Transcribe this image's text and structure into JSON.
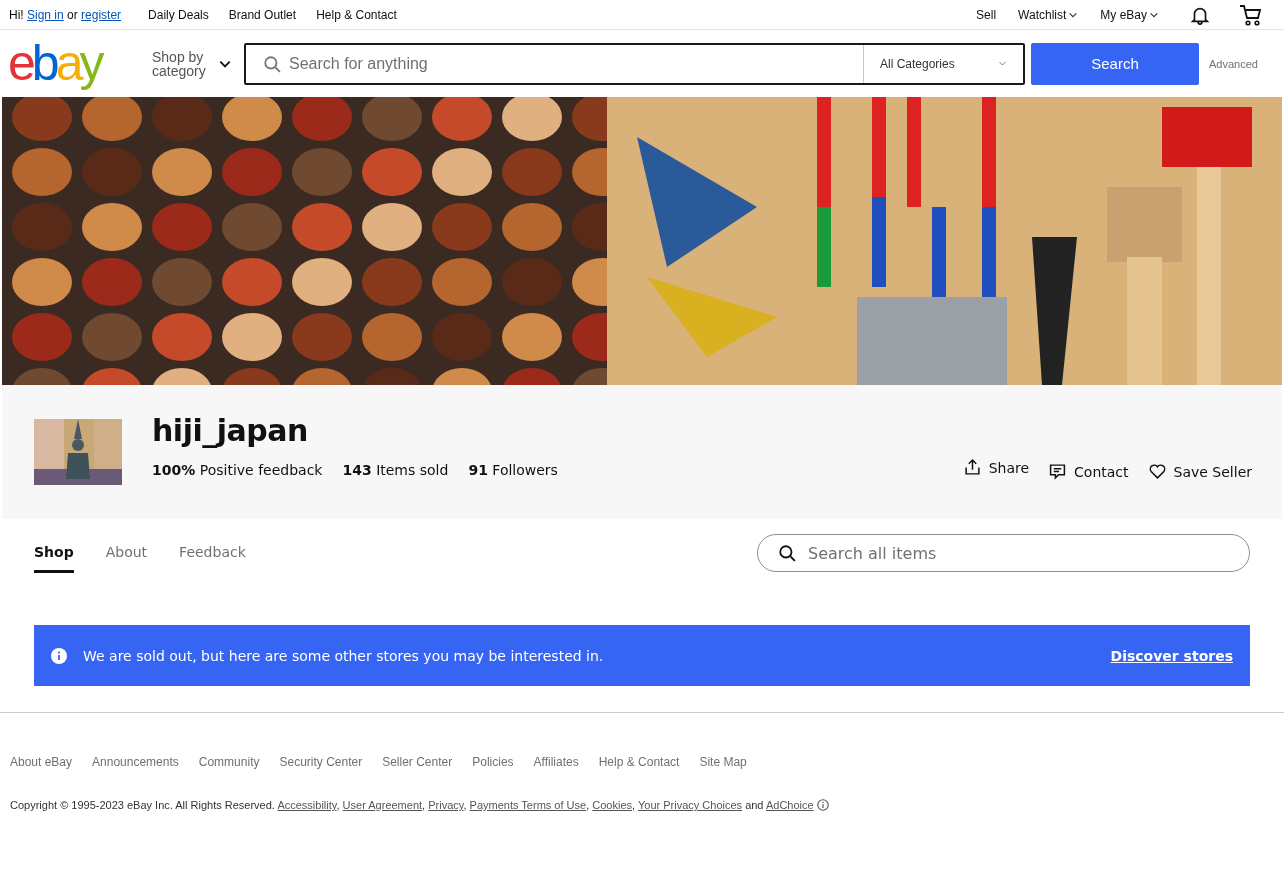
{
  "top_bar": {
    "greeting": "Hi!",
    "sign_in": "Sign in",
    "or": "or",
    "register": "register",
    "links": [
      "Daily Deals",
      "Brand Outlet",
      "Help & Contact"
    ],
    "right_links": [
      {
        "label": "Sell",
        "dropdown": false
      },
      {
        "label": "Watchlist",
        "dropdown": true
      },
      {
        "label": "My eBay",
        "dropdown": true
      }
    ]
  },
  "header": {
    "logo": [
      {
        "text": "e",
        "color": "#e53238"
      },
      {
        "text": "b",
        "color": "#0064d2"
      },
      {
        "text": "a",
        "color": "#f5af02"
      },
      {
        "text": "y",
        "color": "#86b817"
      }
    ],
    "shop_by_category": "Shop by category",
    "search_placeholder": "Search for anything",
    "category": "All Categories",
    "search_button": "Search",
    "advanced": "Advanced"
  },
  "banner": [
    {
      "kind": "crafts"
    },
    {
      "kind": "tools"
    }
  ],
  "seller": {
    "name": "hiji_japan",
    "stats": [
      "**100%** Positive feedback",
      "**143** Items sold",
      "**91** Followers"
    ],
    "actions": [
      {
        "kind": "share",
        "label": "Share"
      },
      {
        "kind": "contact",
        "label": "Contact"
      },
      {
        "kind": "save",
        "label": "Save Seller"
      }
    ]
  },
  "tabs": [
    {
      "label": "Shop",
      "selected": true
    },
    {
      "label": "About",
      "selected": false
    },
    {
      "label": "Feedback",
      "selected": false
    }
  ],
  "store_search": {
    "placeholder": "Search all items"
  },
  "notice": {
    "message": "We are sold out, but here are some other stores you may be interested in.",
    "link": "Discover stores"
  },
  "footer": {
    "links": [
      "About eBay",
      "Announcements",
      "Community",
      "Security Center",
      "Seller Center",
      "Policies",
      "Affiliates",
      "Help & Contact",
      "Site Map"
    ],
    "copyright": [
      {
        "kind": "text",
        "text": "Copyright © 1995-2023 eBay Inc. All Rights Reserved. "
      },
      {
        "kind": "link",
        "text": "Accessibility"
      },
      {
        "kind": "text",
        "text": ", "
      },
      {
        "kind": "link",
        "text": "User Agreement"
      },
      {
        "kind": "text",
        "text": ", "
      },
      {
        "kind": "link",
        "text": "Privacy"
      },
      {
        "kind": "text",
        "text": ", "
      },
      {
        "kind": "link",
        "text": "Payments Terms of Use"
      },
      {
        "kind": "text",
        "text": ", "
      },
      {
        "kind": "link",
        "text": "Cookies"
      },
      {
        "kind": "text",
        "text": ", "
      },
      {
        "kind": "link",
        "text": "Your Privacy Choices"
      },
      {
        "kind": "text",
        "text": " and "
      },
      {
        "kind": "link",
        "text": "AdChoice"
      }
    ]
  }
}
